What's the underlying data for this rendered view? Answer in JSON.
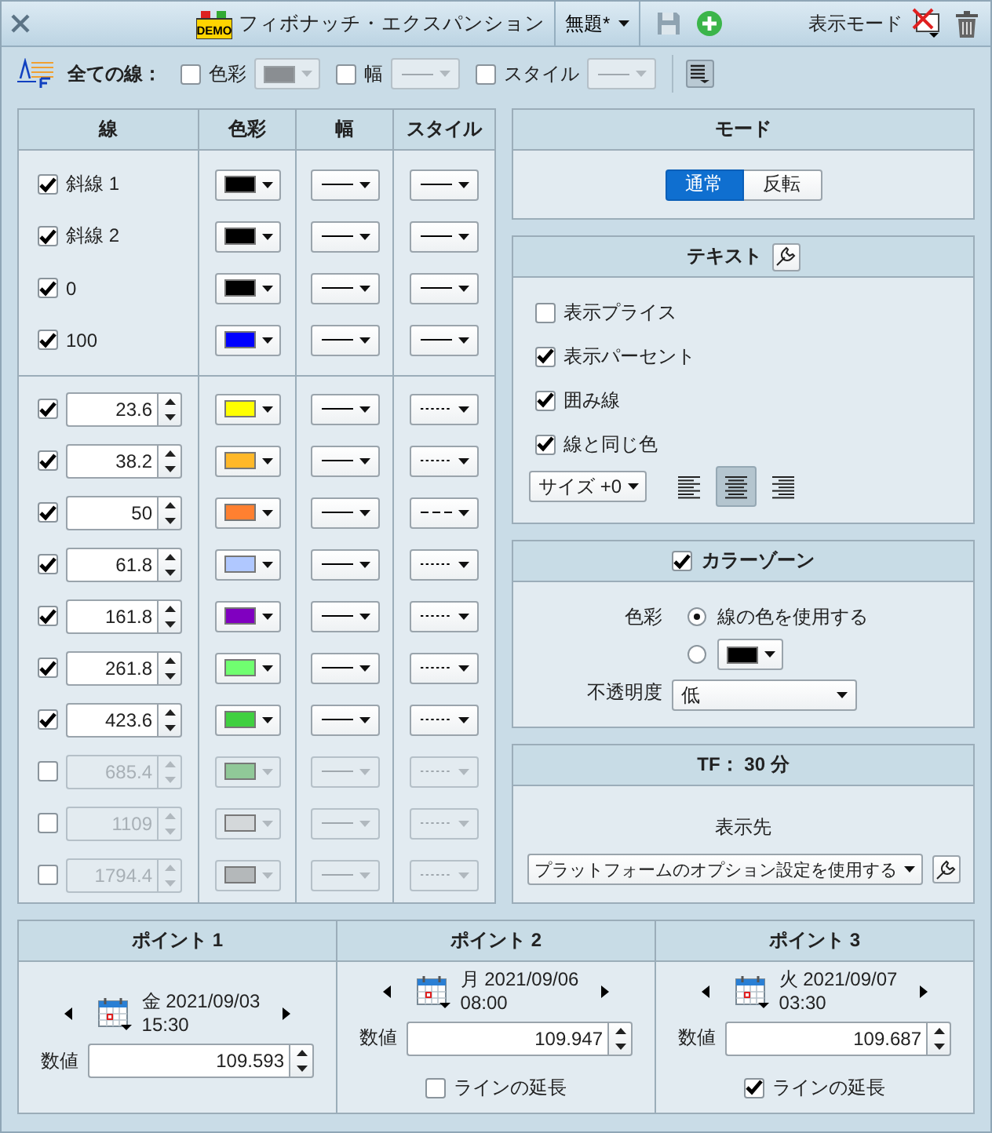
{
  "title_bar": {
    "logo_text": "DEMO",
    "title": "フィボナッチ・エクスパンション",
    "template": "無題*",
    "display_mode_label": "表示モード"
  },
  "toolbar": {
    "label": "全ての線：",
    "options": [
      {
        "kind": "color",
        "label": "色彩",
        "checked": false
      },
      {
        "kind": "width",
        "label": "幅",
        "checked": false
      },
      {
        "kind": "style",
        "label": "スタイル",
        "checked": false
      }
    ]
  },
  "lines_table": {
    "columns": [
      "線",
      "色彩",
      "幅",
      "スタイル"
    ],
    "fixed_rows": [
      {
        "label": "斜線 1",
        "checked": true,
        "color": "#000000",
        "kind": "solid"
      },
      {
        "label": "斜線 2",
        "checked": true,
        "color": "#000000",
        "kind": "solid"
      },
      {
        "label": "0",
        "checked": true,
        "color": "#000000",
        "kind": "solid"
      },
      {
        "label": "100",
        "checked": true,
        "color": "#0000ff",
        "kind": "solid"
      }
    ],
    "level_rows": [
      {
        "value": "23.6",
        "checked": true,
        "color": "#ffff00",
        "kind": "dotted"
      },
      {
        "value": "38.2",
        "checked": true,
        "color": "#ffb829",
        "kind": "dotted"
      },
      {
        "value": "50",
        "checked": true,
        "color": "#ff8030",
        "kind": "dashed"
      },
      {
        "value": "61.8",
        "checked": true,
        "color": "#b0c8ff",
        "kind": "dotted"
      },
      {
        "value": "161.8",
        "checked": true,
        "color": "#8000c0",
        "kind": "dotted"
      },
      {
        "value": "261.8",
        "checked": true,
        "color": "#70ff70",
        "kind": "dotted"
      },
      {
        "value": "423.6",
        "checked": true,
        "color": "#40d040",
        "kind": "dotted"
      },
      {
        "value": "685.4",
        "checked": false,
        "color": "#90c898",
        "kind": "dotted"
      },
      {
        "value": "1109",
        "checked": false,
        "color": "#d4d8da",
        "kind": "dotted"
      },
      {
        "value": "1794.4",
        "checked": false,
        "color": "#b4b8ba",
        "kind": "dotted"
      }
    ]
  },
  "mode": {
    "title": "モード",
    "options": [
      {
        "label": "通常",
        "selected": true
      },
      {
        "label": "反転",
        "selected": false
      }
    ]
  },
  "text": {
    "title": "テキスト",
    "options": [
      {
        "label": "表示プライス",
        "checked": false
      },
      {
        "label": "表示パーセント",
        "checked": true
      },
      {
        "label": "囲み線",
        "checked": true
      },
      {
        "label": "線と同じ色",
        "checked": true
      }
    ],
    "size": "サイズ +0",
    "align": [
      {
        "kind": "left",
        "selected": false
      },
      {
        "kind": "center",
        "selected": true
      },
      {
        "kind": "right",
        "selected": false
      }
    ]
  },
  "color_zone": {
    "title": "カラーゾーン",
    "checked": true,
    "color_label": "色彩",
    "options": [
      {
        "kind": "text",
        "label": "線の色を使用する",
        "selected": true
      },
      {
        "kind": "swatch",
        "color": "#000000",
        "selected": false
      }
    ],
    "opacity_label": "不透明度",
    "opacity": "低"
  },
  "tf": {
    "title": "TF： 30 分",
    "display_label": "表示先",
    "display_value": "プラットフォームのオプション設定を使用する"
  },
  "points": [
    {
      "title": "ポイント 1",
      "date": "金 2021/09/03",
      "time": "15:30",
      "value_label": "数値",
      "value": "109.593"
    },
    {
      "title": "ポイント 2",
      "date": "月 2021/09/06",
      "time": "08:00",
      "value_label": "数値",
      "value": "109.947",
      "extend": {
        "label": "ラインの延長",
        "checked": false
      }
    },
    {
      "title": "ポイント 3",
      "date": "火 2021/09/07",
      "time": "03:30",
      "value_label": "数値",
      "value": "109.687",
      "extend": {
        "label": "ラインの延長",
        "checked": true
      }
    }
  ]
}
